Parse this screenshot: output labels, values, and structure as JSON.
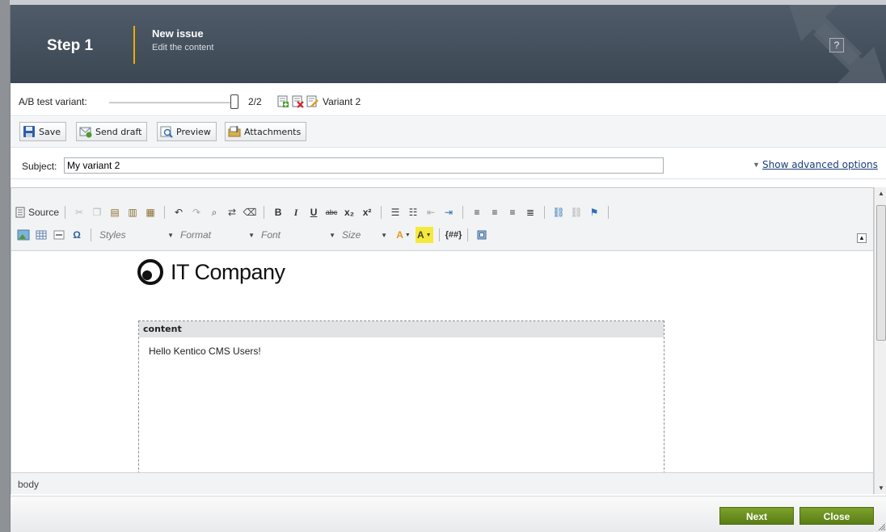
{
  "header": {
    "step": "Step 1",
    "title": "New issue",
    "subtitle": "Edit the content",
    "help": "?"
  },
  "ab_test": {
    "label": "A/B test variant:",
    "position_text": "2/2",
    "current_variant": 2,
    "total_variants": 2,
    "variant_name": "Variant 2",
    "icons": [
      "add-variant-icon",
      "delete-variant-icon",
      "edit-variant-icon"
    ]
  },
  "toolbar": {
    "save": "Save",
    "send_draft": "Send draft",
    "preview": "Preview",
    "attachments": "Attachments"
  },
  "subject": {
    "label": "Subject:",
    "value": "My variant 2",
    "advanced": "Show advanced options"
  },
  "editor": {
    "source_label": "Source",
    "combos": {
      "styles": "Styles",
      "format": "Format",
      "font": "Font",
      "size": "Size"
    },
    "bold": "B",
    "italic": "I",
    "underline": "U",
    "macro": "{##}",
    "element_path": "body"
  },
  "content": {
    "logo_text": "IT Company",
    "zone_name": "content",
    "body_text": "Hello Kentico CMS Users!"
  },
  "footer": {
    "next": "Next",
    "close": "Close"
  },
  "colors": {
    "header_bg": "#46515e",
    "step_divider": "#f2a900",
    "action_green": "#6b8f1f",
    "link": "#1a3c7a"
  }
}
